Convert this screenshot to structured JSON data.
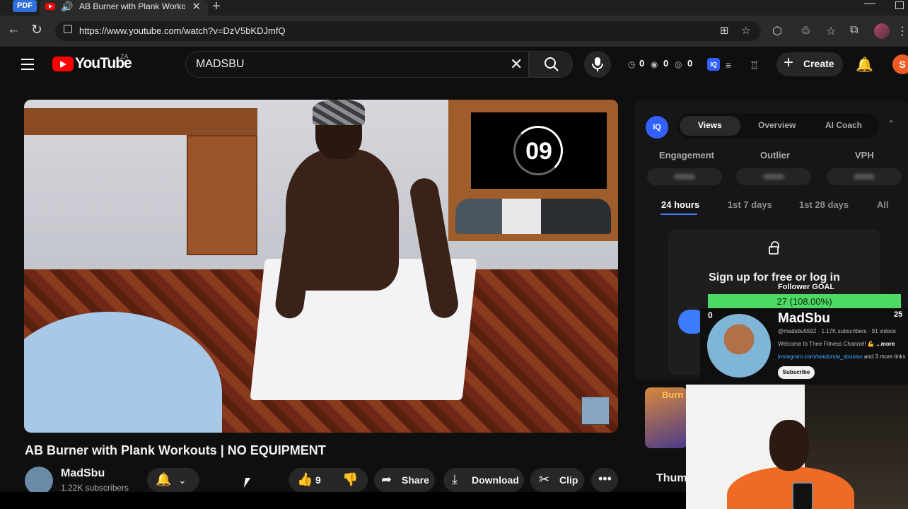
{
  "browser": {
    "pdf_badge": "PDF",
    "tab_title": "AB Burner with Plank Workouts",
    "url": "https://www.youtube.com/watch?v=DzV5bKDJmfQ"
  },
  "header": {
    "logo_text": "YouTube",
    "region": "ZA",
    "search_value": "MADSBU",
    "stats": [
      "0",
      "0",
      "0"
    ],
    "create_label": "Create",
    "user_initial": "S"
  },
  "video": {
    "timer": "09",
    "title": "AB Burner with Plank Workouts | NO EQUIPMENT"
  },
  "channel": {
    "name": "MadSbu",
    "subscribers": "1.22K subscribers"
  },
  "actions": {
    "likes": "9",
    "share": "Share",
    "download": "Download",
    "clip": "Clip"
  },
  "panel": {
    "logo": "IQ",
    "tabs": [
      "Views",
      "Overview",
      "AI Coach"
    ],
    "metrics": [
      "Engagement",
      "Outlier",
      "VPH"
    ],
    "ranges": [
      "24 hours",
      "1st 7 days",
      "1st 28 days",
      "All"
    ],
    "lock_text": "Sign up for free or log in"
  },
  "related": {
    "burn_label": "Burn",
    "thumb_label": "Thum"
  },
  "goal": {
    "label": "Follower GOAL",
    "value": "27 (108.00%)",
    "start": "0",
    "target": "25",
    "progress": 1.0
  },
  "card": {
    "name": "MadSbu",
    "meta": "@madsbu5592 · 1.17K subscribers · 91 videos",
    "desc": "Welcome to Thee Fitness Channel! 💪",
    "more": "...more",
    "link": "instagram.com/madonda_sbusiso",
    "more_links": "and 3 more links",
    "subscribe": "Subscribe"
  }
}
